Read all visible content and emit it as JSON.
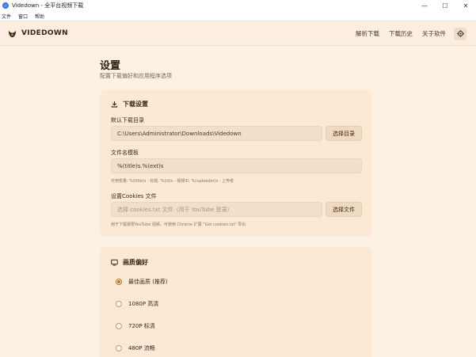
{
  "window": {
    "title": "Videdown - 全平台视频下载",
    "controls": {
      "minimize": "—",
      "maximize": "☐",
      "close": "✕"
    }
  },
  "menubar": {
    "items": [
      "文件",
      "窗口",
      "帮助"
    ]
  },
  "appbar": {
    "brand": "VIDEDOWN",
    "nav": [
      "解析下载",
      "下载历史",
      "关于软件"
    ],
    "settings_icon": "gear-icon"
  },
  "page": {
    "title": "设置",
    "subtitle": "配置下载偏好和应用程序选项"
  },
  "download_settings": {
    "header": "下载设置",
    "dir_label": "默认下载目录",
    "dir_value": "C:\\Users\\Administrator\\Downloads\\Videdown",
    "dir_button": "选择目录",
    "template_label": "文件名模板",
    "template_value": "%(title)s.%(ext)s",
    "template_hint": "可用变量: %(title)s - 标题, %(id)s - 视频ID, %(uploader)s - 上传者",
    "cookies_label": "设置Cookies 文件",
    "cookies_placeholder": "选择 cookies.txt 文件（用于 YouTube 登录）",
    "cookies_button": "选择文件",
    "cookies_hint": "用于下载受限YouTube 视频。可使用 Chrome 扩展 \"Get cookies.txt\" 导出"
  },
  "quality": {
    "header": "画质偏好",
    "options": [
      {
        "label": "最佳画质 (推荐)",
        "checked": true
      },
      {
        "label": "1080P 高清",
        "checked": false
      },
      {
        "label": "720P 标清",
        "checked": false
      },
      {
        "label": "480P 流畅",
        "checked": false
      }
    ]
  },
  "colors": {
    "background": "#fdf1e4",
    "card": "#fbe9d6",
    "accent": "#b8741f"
  }
}
